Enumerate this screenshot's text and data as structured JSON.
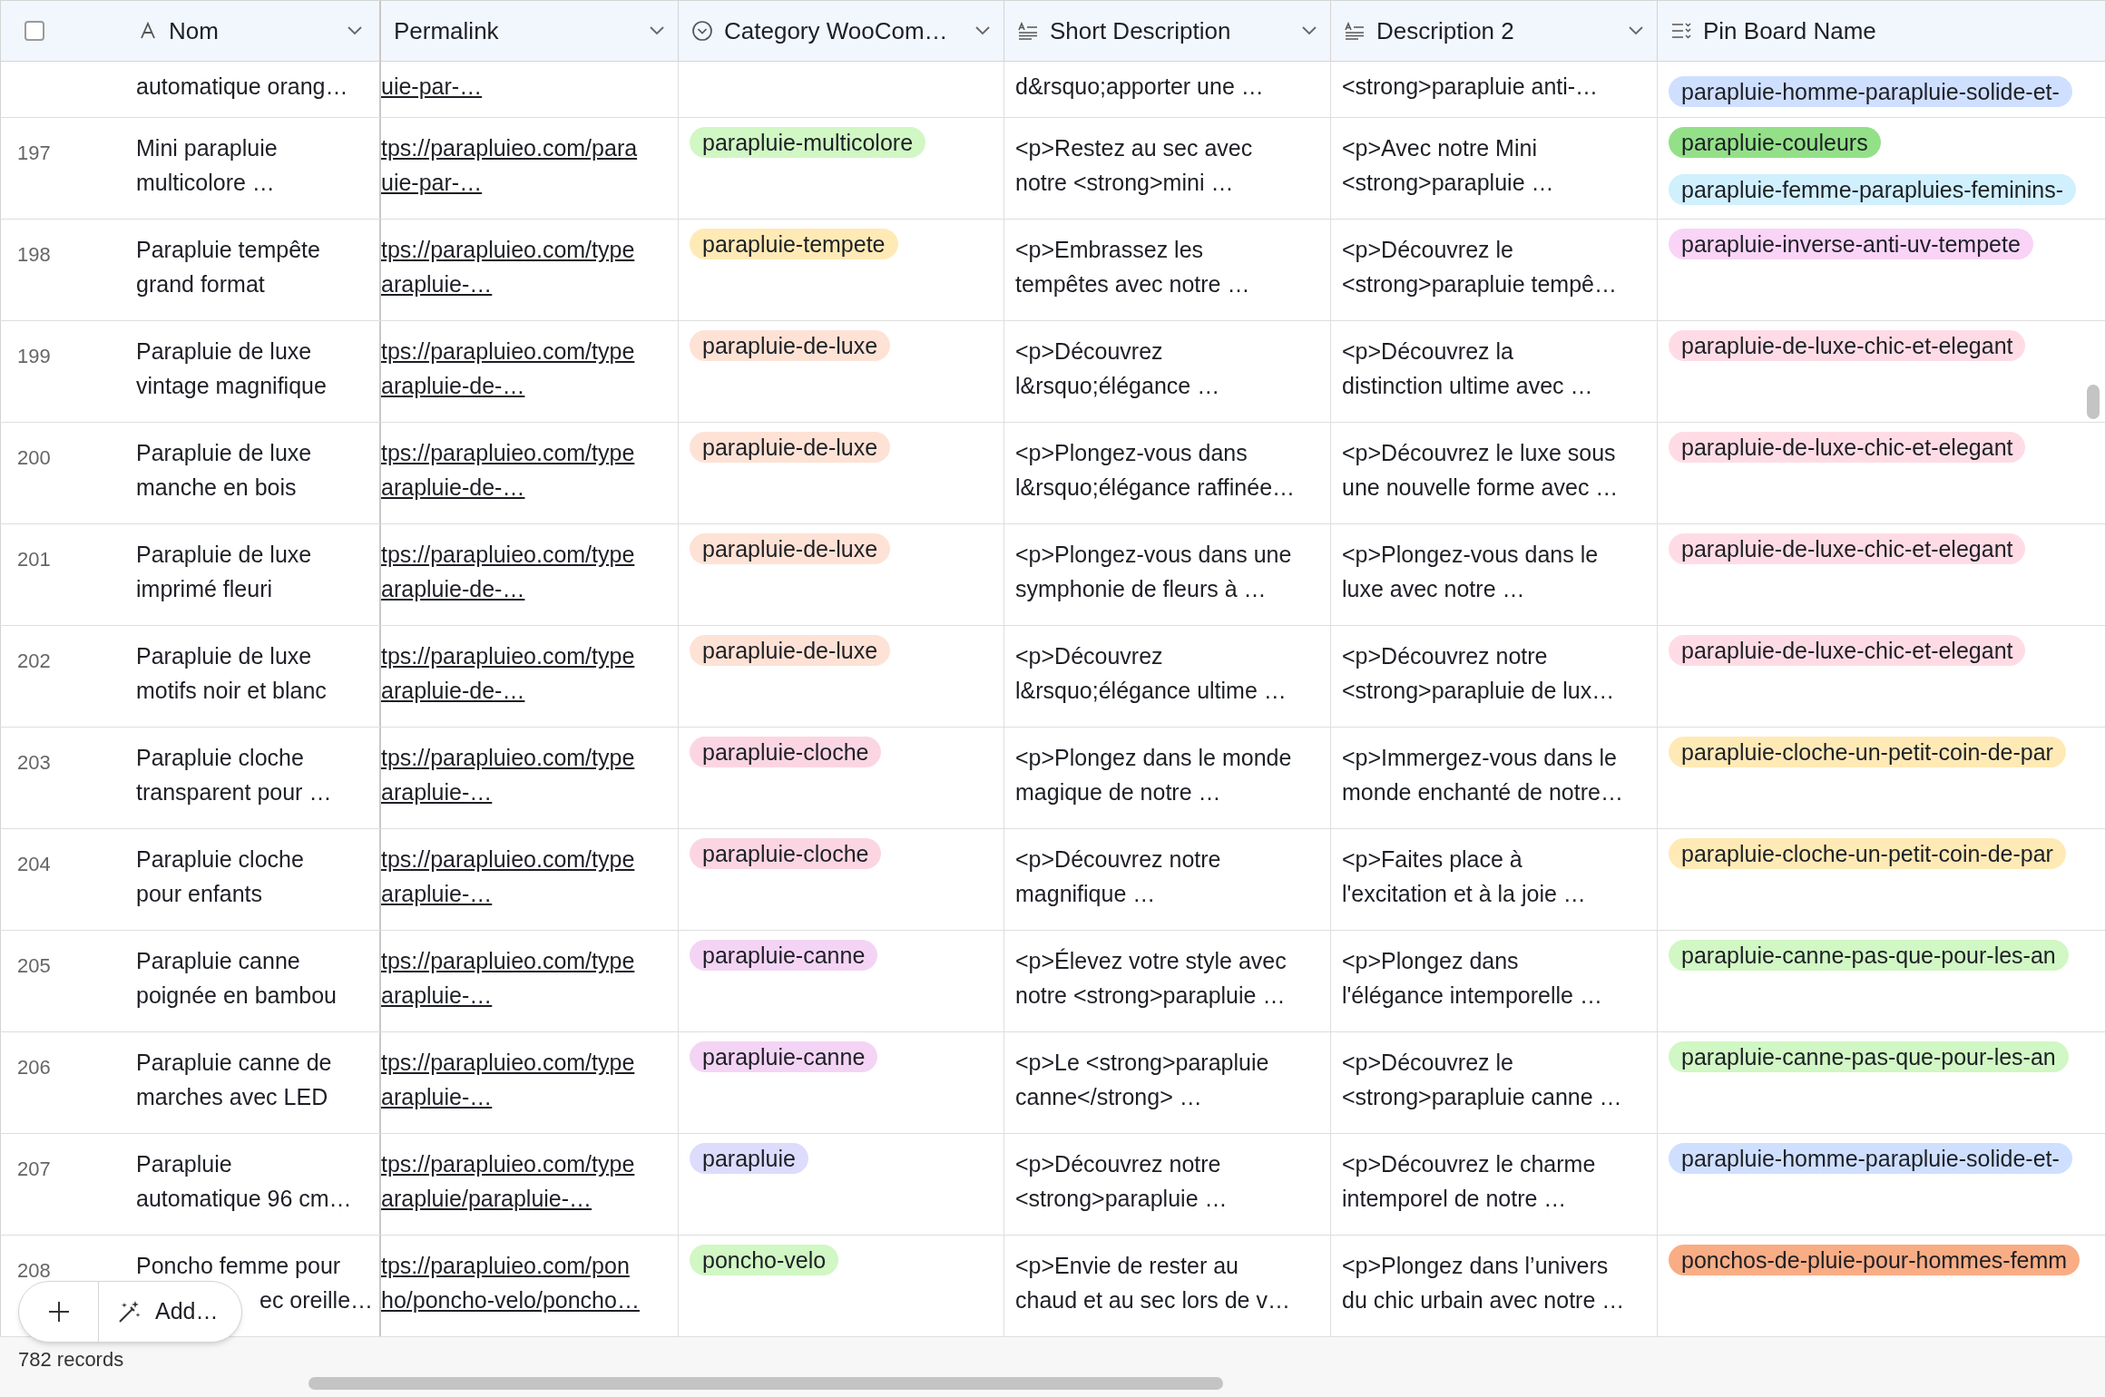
{
  "header_checkbox": {
    "checked": false
  },
  "columns": [
    {
      "label": "Nom",
      "kind": "text",
      "menu": true
    },
    {
      "label": "Permalink",
      "kind": "url",
      "menu": true
    },
    {
      "label": "Category WooCom…",
      "kind": "select",
      "menu": true
    },
    {
      "label": "Short Description",
      "kind": "longtext",
      "menu": true
    },
    {
      "label": "Description 2",
      "kind": "longtext",
      "menu": true
    },
    {
      "label": "Pin Board Name",
      "kind": "multiselect",
      "menu": false
    }
  ],
  "rows": [
    {
      "number": "",
      "name": [
        "automatique orang…"
      ],
      "permalink": [
        "uie-par-…"
      ],
      "category": [],
      "short": [
        "d&rsquo;apporter une …"
      ],
      "desc": [
        "<strong>parapluie anti-…"
      ],
      "pins": [
        {
          "label": "parapluie-homme-parapluie-solide-et-",
          "color": "#cfdfff"
        }
      ]
    },
    {
      "number": "197",
      "name": [
        "Mini parapluie",
        "multicolore …"
      ],
      "permalink": [
        "tps://parapluieo.com/para",
        "uie-par-…"
      ],
      "category": [
        {
          "label": "parapluie-multicolore",
          "color": "#d1f7c4"
        }
      ],
      "short": [
        "<p>Restez au sec avec",
        "notre <strong>mini …"
      ],
      "desc": [
        "<p>Avec notre Mini",
        "<strong>parapluie …"
      ],
      "pins": [
        {
          "label": "parapluie-couleurs",
          "color": "#93e088"
        },
        {
          "label": "parapluie-femme-parapluies-feminins-",
          "color": "#d0f0fd"
        }
      ]
    },
    {
      "number": "198",
      "name": [
        "Parapluie tempête",
        "grand format"
      ],
      "permalink": [
        "tps://parapluieo.com/type",
        "arapluie-…"
      ],
      "category": [
        {
          "label": "parapluie-tempete",
          "color": "#ffeab6"
        }
      ],
      "short": [
        "<p>Embrassez les",
        "tempêtes avec notre …"
      ],
      "desc": [
        "<p>Découvrez le",
        "<strong>parapluie tempê…"
      ],
      "pins": [
        {
          "label": "parapluie-inverse-anti-uv-tempete",
          "color": "#f9d4f7"
        }
      ]
    },
    {
      "number": "199",
      "name": [
        "Parapluie de luxe",
        "vintage magnifique"
      ],
      "permalink": [
        "tps://parapluieo.com/type",
        "arapluie-de-…"
      ],
      "category": [
        {
          "label": "parapluie-de-luxe",
          "color": "#fee2d5"
        }
      ],
      "short": [
        "<p>Découvrez",
        "l&rsquo;élégance …"
      ],
      "desc": [
        "<p>Découvrez la",
        "distinction ultime avec …"
      ],
      "pins": [
        {
          "label": "parapluie-de-luxe-chic-et-elegant",
          "color": "#ffdce5"
        }
      ]
    },
    {
      "number": "200",
      "name": [
        "Parapluie de luxe",
        "manche en bois"
      ],
      "permalink": [
        "tps://parapluieo.com/type",
        "arapluie-de-…"
      ],
      "category": [
        {
          "label": "parapluie-de-luxe",
          "color": "#fee2d5"
        }
      ],
      "short": [
        "<p>Plongez-vous dans",
        "l&rsquo;élégance raffinée…"
      ],
      "desc": [
        "<p>Découvrez le luxe sous",
        "une nouvelle forme avec …"
      ],
      "pins": [
        {
          "label": "parapluie-de-luxe-chic-et-elegant",
          "color": "#ffdce5"
        }
      ]
    },
    {
      "number": "201",
      "name": [
        "Parapluie de luxe",
        "imprimé fleuri"
      ],
      "permalink": [
        "tps://parapluieo.com/type",
        "arapluie-de-…"
      ],
      "category": [
        {
          "label": "parapluie-de-luxe",
          "color": "#fee2d5"
        }
      ],
      "short": [
        "<p>Plongez-vous dans une",
        "symphonie de fleurs à …"
      ],
      "desc": [
        "<p>Plongez-vous dans le",
        "luxe avec notre …"
      ],
      "pins": [
        {
          "label": "parapluie-de-luxe-chic-et-elegant",
          "color": "#ffdce5"
        }
      ]
    },
    {
      "number": "202",
      "name": [
        "Parapluie de luxe",
        "motifs noir et blanc"
      ],
      "permalink": [
        "tps://parapluieo.com/type",
        "arapluie-de-…"
      ],
      "category": [
        {
          "label": "parapluie-de-luxe",
          "color": "#fee2d5"
        }
      ],
      "short": [
        "<p>Découvrez",
        "l&rsquo;élégance ultime …"
      ],
      "desc": [
        "<p>Découvrez notre",
        "<strong>parapluie de lux…"
      ],
      "pins": [
        {
          "label": "parapluie-de-luxe-chic-et-elegant",
          "color": "#ffdce5"
        }
      ]
    },
    {
      "number": "203",
      "name": [
        "Parapluie cloche",
        "transparent pour …"
      ],
      "permalink": [
        "tps://parapluieo.com/type",
        "arapluie-…"
      ],
      "category": [
        {
          "label": "parapluie-cloche",
          "color": "#fbd6e2"
        }
      ],
      "short": [
        "<p>Plongez dans le monde",
        "magique de notre …"
      ],
      "desc": [
        "<p>Immergez-vous dans le",
        "monde enchanté de notre…"
      ],
      "pins": [
        {
          "label": "parapluie-cloche-un-petit-coin-de-par",
          "color": "#ffeab6"
        }
      ]
    },
    {
      "number": "204",
      "name": [
        "Parapluie cloche",
        "pour enfants"
      ],
      "permalink": [
        "tps://parapluieo.com/type",
        "arapluie-…"
      ],
      "category": [
        {
          "label": "parapluie-cloche",
          "color": "#fbd6e2"
        }
      ],
      "short": [
        "<p>Découvrez notre",
        "magnifique …"
      ],
      "desc": [
        "<p>Faites place à",
        "l'excitation et à la joie …"
      ],
      "pins": [
        {
          "label": "parapluie-cloche-un-petit-coin-de-par",
          "color": "#ffeab6"
        }
      ]
    },
    {
      "number": "205",
      "name": [
        "Parapluie canne",
        "poignée en bambou"
      ],
      "permalink": [
        "tps://parapluieo.com/type",
        "arapluie-…"
      ],
      "category": [
        {
          "label": "parapluie-canne",
          "color": "#f4d4f5"
        }
      ],
      "short": [
        "<p>Élevez votre style avec",
        "notre <strong>parapluie …"
      ],
      "desc": [
        "<p>Plongez dans",
        "l'élégance intemporelle …"
      ],
      "pins": [
        {
          "label": "parapluie-canne-pas-que-pour-les-an",
          "color": "#d1f7c4"
        }
      ]
    },
    {
      "number": "206",
      "name": [
        "Parapluie canne de",
        "marches avec LED"
      ],
      "permalink": [
        "tps://parapluieo.com/type",
        "arapluie-…"
      ],
      "category": [
        {
          "label": "parapluie-canne",
          "color": "#f4d4f5"
        }
      ],
      "short": [
        "<p>Le <strong>parapluie",
        "canne</strong> …"
      ],
      "desc": [
        "<p>Découvrez le",
        "<strong>parapluie canne …"
      ],
      "pins": [
        {
          "label": "parapluie-canne-pas-que-pour-les-an",
          "color": "#d1f7c4"
        }
      ]
    },
    {
      "number": "207",
      "name": [
        "Parapluie",
        "automatique 96 cm…"
      ],
      "permalink": [
        "tps://parapluieo.com/type",
        "arapluie/parapluie-…"
      ],
      "category": [
        {
          "label": "parapluie",
          "color": "#dedcfc"
        }
      ],
      "short": [
        "<p>Découvrez notre",
        "<strong>parapluie …"
      ],
      "desc": [
        "<p>Découvrez le charme",
        "intemporel de notre …"
      ],
      "pins": [
        {
          "label": "parapluie-homme-parapluie-solide-et-",
          "color": "#cfdfff"
        }
      ]
    },
    {
      "number": "208",
      "name": [
        "Poncho femme pour",
        "ec oreille…"
      ],
      "permalink": [
        "tps://parapluieo.com/pon",
        "ho/poncho-velo/poncho…"
      ],
      "category": [
        {
          "label": "poncho-velo",
          "color": "#d1f7c4"
        }
      ],
      "short": [
        "<p>Envie de rester au",
        "chaud et au sec lors de v…"
      ],
      "desc": [
        "<p>Plongez dans l’univers",
        "du chic urbain avec notre …"
      ],
      "pins": [
        {
          "label": "ponchos-de-pluie-pour-hommes-femm",
          "color": "#f9ad85"
        }
      ]
    }
  ],
  "add_bar": {
    "label": "Add…"
  },
  "footer": {
    "records": "782 records"
  }
}
